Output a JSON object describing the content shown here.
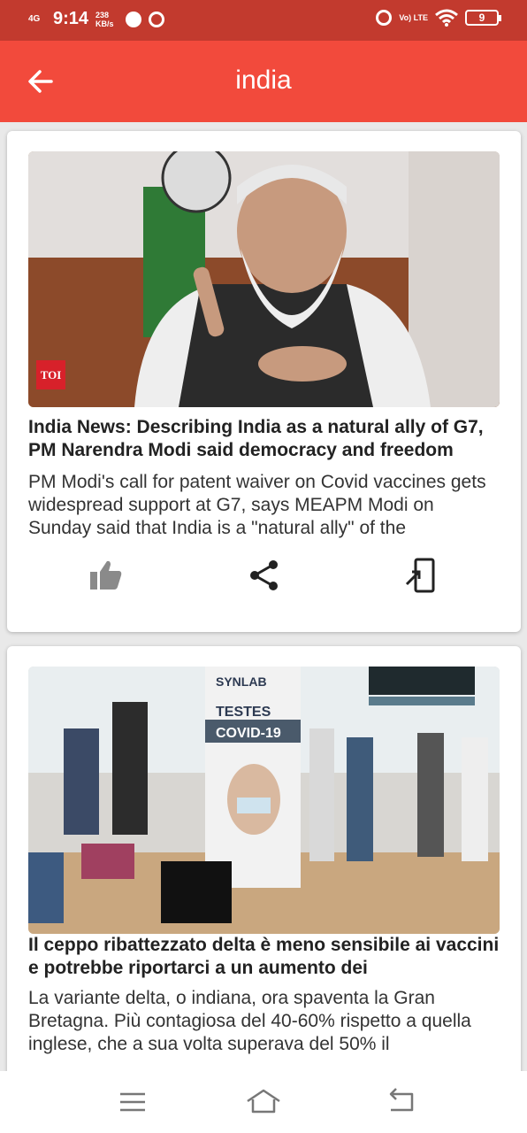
{
  "status_bar": {
    "network": "4G",
    "time": "9:14",
    "speed": "238 KB/s",
    "volte": "Vo) LTE",
    "battery": "9"
  },
  "app_bar": {
    "title": "india"
  },
  "articles": [
    {
      "source_badge": "TOI",
      "headline": "India News: Describing India as a natural ally of G7, PM Narendra Modi said democracy and freedom",
      "summary": "PM Modi's call for patent waiver on Covid vaccines gets widespread support at G7, says MEAPM Modi on Sunday said that India is a \"natural ally\" of the"
    },
    {
      "image_text": {
        "brand": "SYNLAB",
        "line1": "TESTES",
        "line2": "COVID-19"
      },
      "headline": "Il ceppo ribattezzato delta è meno sensibile ai vaccini e potrebbe riportarci a un aumento dei",
      "summary": "La variante delta, o indiana, ora spaventa la Gran Bretagna. Più contagiosa del 40-60% rispetto a quella inglese, che a sua volta superava del 50% il"
    }
  ],
  "icons": {
    "back": "arrow-left-icon",
    "like": "thumb-up-icon",
    "share": "share-icon",
    "open": "open-in-app-icon",
    "nav_menu": "menu-icon",
    "nav_home": "home-icon",
    "nav_back": "back-icon"
  },
  "colors": {
    "status_bar": "#c23a2e",
    "app_bar": "#f24a3c",
    "badge": "#d7212a"
  }
}
